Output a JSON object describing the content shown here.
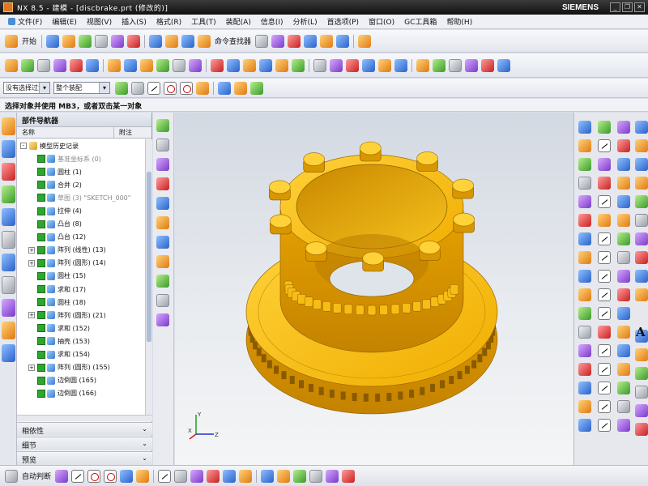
{
  "window": {
    "title": "NX 8.5 - 建模 - [discbrake.prt (修改的)]",
    "brand": "SIEMENS",
    "controls": [
      "minimize-icon",
      "restore-icon",
      "close-icon"
    ]
  },
  "menu": {
    "items": [
      "文件(F)",
      "编辑(E)",
      "视图(V)",
      "插入(S)",
      "格式(R)",
      "工具(T)",
      "装配(A)",
      "信息(I)",
      "分析(L)",
      "首选项(P)",
      "窗口(O)",
      "GC工具箱",
      "帮助(H)"
    ]
  },
  "toolbar1": {
    "start_label": "开始",
    "command_finder_label": "命令查找器",
    "icons": [
      "new-icon",
      "open-icon",
      "save-icon",
      "cut-icon",
      "copy-icon",
      "paste-icon",
      "delete-icon",
      "undo-icon",
      "redo-icon",
      "fit-icon",
      "zoom-icon",
      "rotate-icon",
      "render-icon",
      "layer-icon",
      "move-icon",
      "wcs-icon",
      "measure-icon"
    ]
  },
  "toolbar2": {
    "icons": [
      "sketch-icon",
      "extrude-icon",
      "revolve-icon",
      "hole-icon",
      "boss-icon",
      "pocket-icon",
      "pad-icon",
      "slot-icon",
      "groove-icon",
      "block-icon",
      "cylinder-icon",
      "cone-icon",
      "sphere-icon",
      "unite-icon",
      "subtract-icon",
      "intersect-icon",
      "edge-blend-icon",
      "chamfer-icon",
      "shell-icon",
      "draft-icon",
      "pattern-icon",
      "mirror-icon",
      "trim-icon",
      "offset-icon",
      "thicken-icon",
      "datum-plane-icon",
      "datum-axis-icon",
      "csys-icon",
      "point-icon",
      "expression-icon"
    ]
  },
  "selectionbar": {
    "filter_value": "没有选择过滤器",
    "scope_value": "整个装配",
    "icons": [
      "snap-icon",
      "point-snap-icon",
      "line-icon",
      "circle-icon",
      "arc-icon",
      "control-point-icon",
      "intersection-icon",
      "midpoint-icon",
      "quadrant-icon"
    ]
  },
  "prompt": "选择对象并使用 MB3，或者双击某一对象",
  "navigator": {
    "title": "部件导航器",
    "col_name": "名称",
    "col_latest": "附注",
    "features": [
      {
        "label": "模型历史记录",
        "level": 0,
        "expand": "-",
        "kind": "folder",
        "dim": false
      },
      {
        "label": "基准坐标系 (0)",
        "level": 1,
        "expand": "",
        "kind": "csys",
        "dim": true
      },
      {
        "label": "圆柱 (1)",
        "level": 1,
        "expand": "",
        "kind": "feat",
        "dim": false
      },
      {
        "label": "合并 (2)",
        "level": 1,
        "expand": "",
        "kind": "feat",
        "dim": false
      },
      {
        "label": "草图 (3) \"SKETCH_000\"",
        "level": 1,
        "expand": "",
        "kind": "sketch",
        "dim": true
      },
      {
        "label": "拉伸 (4)",
        "level": 1,
        "expand": "",
        "kind": "feat",
        "dim": false
      },
      {
        "label": "凸台 (8)",
        "level": 1,
        "expand": "",
        "kind": "feat",
        "dim": false
      },
      {
        "label": "凸台 (12)",
        "level": 1,
        "expand": "",
        "kind": "feat",
        "dim": false
      },
      {
        "label": "阵列 (线性) (13)",
        "level": 1,
        "expand": "+",
        "kind": "feat",
        "dim": false
      },
      {
        "label": "阵列 (圆形) (14)",
        "level": 1,
        "expand": "+",
        "kind": "feat",
        "dim": false
      },
      {
        "label": "圆柱 (15)",
        "level": 1,
        "expand": "",
        "kind": "feat",
        "dim": false
      },
      {
        "label": "求和 (17)",
        "level": 1,
        "expand": "",
        "kind": "feat",
        "dim": false
      },
      {
        "label": "圆柱 (18)",
        "level": 1,
        "expand": "",
        "kind": "feat",
        "dim": false
      },
      {
        "label": "阵列 (圆形) (21)",
        "level": 1,
        "expand": "+",
        "kind": "feat",
        "dim": false
      },
      {
        "label": "求和 (152)",
        "level": 1,
        "expand": "",
        "kind": "feat",
        "dim": false
      },
      {
        "label": "抽壳 (153)",
        "level": 1,
        "expand": "",
        "kind": "feat",
        "dim": false
      },
      {
        "label": "求和 (154)",
        "level": 1,
        "expand": "",
        "kind": "feat",
        "dim": false
      },
      {
        "label": "阵列 (圆形) (155)",
        "level": 1,
        "expand": "+",
        "kind": "feat",
        "dim": false
      },
      {
        "label": "边倒圆 (165)",
        "level": 1,
        "expand": "",
        "kind": "feat",
        "dim": false
      },
      {
        "label": "边倒圆 (166)",
        "level": 1,
        "expand": "",
        "kind": "feat",
        "dim": false
      }
    ],
    "panels": [
      "相依性",
      "细节",
      "预览"
    ]
  },
  "model": {
    "name": "brake-disc",
    "color": "#f2b705",
    "lug_count": 10
  },
  "triad": {
    "x": "X",
    "y": "Y",
    "z": "Z"
  },
  "rightbar_letter": "A",
  "bottombar": {
    "label": "自动判断",
    "icons": [
      "profile-icon",
      "line-icon",
      "arc-icon",
      "circle-icon",
      "rectangle-icon",
      "polygon-icon",
      "spline-icon",
      "fillet-icon",
      "chamfer-icon",
      "trim-icon",
      "extend-icon",
      "offset-icon",
      "mirror-icon",
      "pattern-icon",
      "constraint-icon",
      "dimension-icon",
      "point-icon",
      "ellipse-icon"
    ]
  },
  "colors": {
    "title_bar": "#1e1e1e",
    "model_yellow": "#f2b705",
    "model_shadow": "#c98c00",
    "graphics_bg": "#e3e7ec"
  }
}
